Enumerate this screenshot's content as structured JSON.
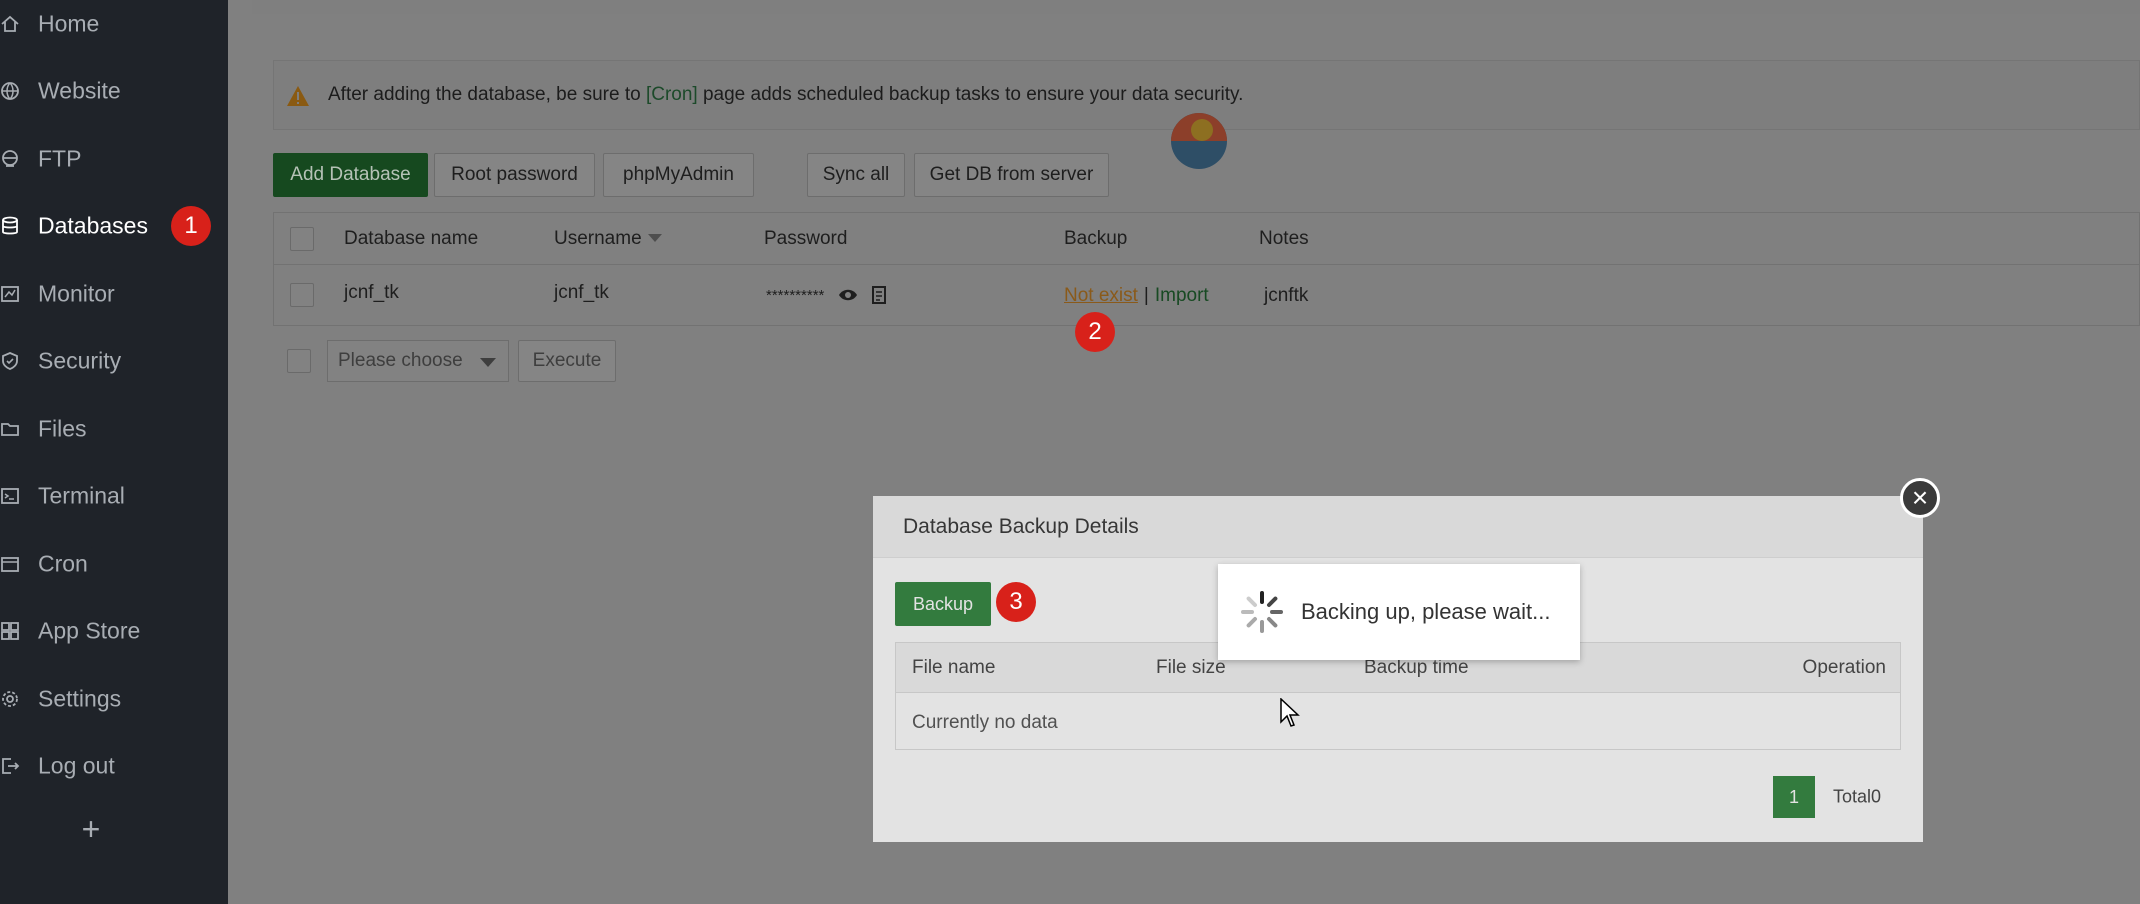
{
  "sidebar": {
    "items": [
      {
        "label": "Home",
        "icon": "home-icon"
      },
      {
        "label": "Website",
        "icon": "globe-icon"
      },
      {
        "label": "FTP",
        "icon": "ftp-icon"
      },
      {
        "label": "Databases",
        "icon": "database-icon",
        "active": true,
        "badge": "1"
      },
      {
        "label": "Monitor",
        "icon": "monitor-icon"
      },
      {
        "label": "Security",
        "icon": "shield-icon"
      },
      {
        "label": "Files",
        "icon": "folder-icon"
      },
      {
        "label": "Terminal",
        "icon": "terminal-icon"
      },
      {
        "label": "Cron",
        "icon": "calendar-icon"
      },
      {
        "label": "App Store",
        "icon": "grid-icon"
      },
      {
        "label": "Settings",
        "icon": "gear-icon"
      },
      {
        "label": "Log out",
        "icon": "logout-icon"
      }
    ],
    "add_label": "+"
  },
  "alert": {
    "text_before": "After adding the database, be sure to ",
    "link": "[Cron]",
    "text_after": " page adds scheduled backup tasks to ensure your data security."
  },
  "toolbar": {
    "add_database": "Add Database",
    "root_password": "Root password",
    "phpmyadmin": "phpMyAdmin",
    "sync_all": "Sync all",
    "get_db": "Get DB from server"
  },
  "table": {
    "headers": {
      "name": "Database name",
      "username": "Username",
      "password": "Password",
      "backup": "Backup",
      "notes": "Notes"
    },
    "rows": [
      {
        "name": "jcnf_tk",
        "username": "jcnf_tk",
        "password": "**********",
        "backup_status": "Not exist",
        "backup_sep": "|",
        "import": "Import",
        "notes": "jcnftk"
      }
    ],
    "row_badge": "2"
  },
  "batch": {
    "placeholder": "Please choose",
    "execute": "Execute"
  },
  "modal": {
    "title": "Database Backup Details",
    "close": "×",
    "backup_button": "Backup",
    "backup_badge": "3",
    "columns": {
      "file_name": "File name",
      "file_size": "File size",
      "backup_time": "Backup time",
      "operation": "Operation"
    },
    "empty": "Currently no data",
    "page": "1",
    "total": "Total0"
  },
  "toast": {
    "text": "Backing up, please wait..."
  },
  "colors": {
    "sidebar_bg": "#1f2329",
    "accent_green": "#1e7a2c",
    "badge_red": "#d8211a",
    "overlay": "#808080"
  }
}
